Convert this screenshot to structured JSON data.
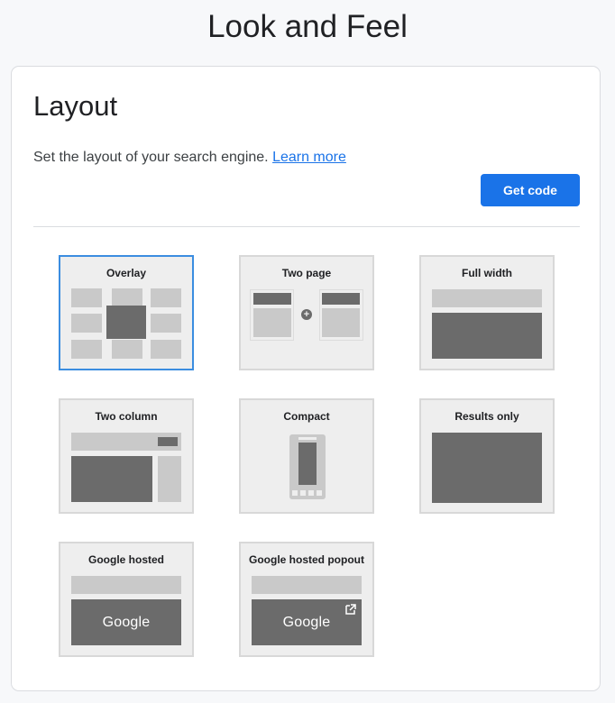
{
  "header": {
    "title": "Look and Feel"
  },
  "layout_section": {
    "title": "Layout",
    "description": "Set the layout of your search engine.",
    "learn_more": "Learn more",
    "get_code": "Get code"
  },
  "tiles": [
    {
      "id": "overlay",
      "label": "Overlay",
      "selected": true
    },
    {
      "id": "two-page",
      "label": "Two page",
      "selected": false
    },
    {
      "id": "full-width",
      "label": "Full width",
      "selected": false
    },
    {
      "id": "two-column",
      "label": "Two column",
      "selected": false
    },
    {
      "id": "compact",
      "label": "Compact",
      "selected": false
    },
    {
      "id": "results-only",
      "label": "Results only",
      "selected": false
    },
    {
      "id": "google-hosted",
      "label": "Google hosted",
      "selected": false,
      "preview_word": "Google"
    },
    {
      "id": "google-hosted-popout",
      "label": "Google hosted popout",
      "selected": false,
      "preview_word": "Google"
    }
  ],
  "colors": {
    "accent": "#1a73e8",
    "selected_border": "#3b8de0",
    "tile_bg": "#eeeeee",
    "preview_light": "#c9c9c9",
    "preview_dark": "#6b6b6b"
  }
}
